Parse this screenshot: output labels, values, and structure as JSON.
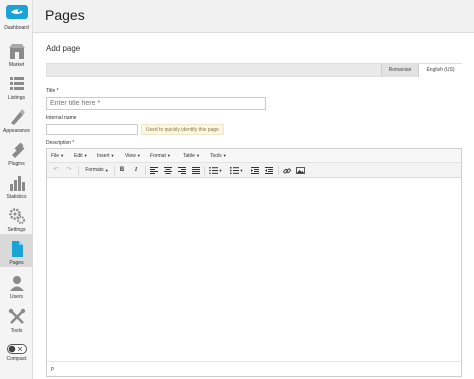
{
  "sidebar": {
    "items": [
      {
        "label": "Dashboard",
        "icon": "dashboard-icon"
      },
      {
        "label": "Market",
        "icon": "market-icon"
      },
      {
        "label": "Listings",
        "icon": "listings-icon"
      },
      {
        "label": "Appearance",
        "icon": "appearance-icon"
      },
      {
        "label": "Plugins",
        "icon": "plugins-icon"
      },
      {
        "label": "Statistics",
        "icon": "statistics-icon"
      },
      {
        "label": "Settings",
        "icon": "settings-icon"
      },
      {
        "label": "Pages",
        "icon": "pages-icon"
      },
      {
        "label": "Users",
        "icon": "users-icon"
      },
      {
        "label": "Tools",
        "icon": "tools-icon"
      },
      {
        "label": "Compact",
        "icon": "toggle-icon"
      }
    ],
    "active": "Pages"
  },
  "header": {
    "title": "Pages"
  },
  "form": {
    "heading": "Add page",
    "languages": [
      "Romanian",
      "English (US)"
    ],
    "active_language": "English (US)",
    "title_label": "Title *",
    "title_placeholder": "Enter title here *",
    "internal_label": "Internal name",
    "internal_value": "",
    "internal_hint": "Used to quickly identify this page",
    "description_label": "Description *"
  },
  "editor": {
    "menus": [
      "File",
      "Edit",
      "Insert",
      "View",
      "Format",
      "Table",
      "Tools"
    ],
    "formats_label": "Formats",
    "status_path": "p"
  },
  "colors": {
    "pages_icon": "#1aa3d6",
    "sidebar_bg": "#f4f4f4",
    "header_bg": "#f1f1f1",
    "hint_bg": "#fdf6e3"
  }
}
